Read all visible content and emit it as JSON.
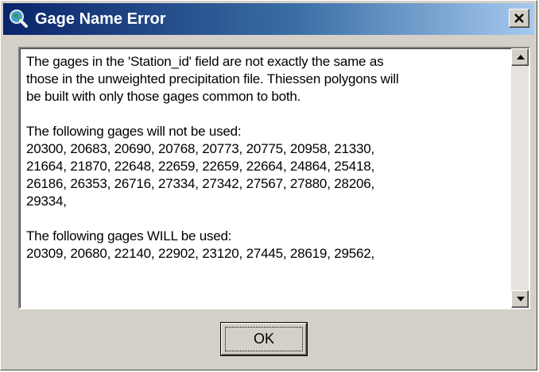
{
  "window": {
    "title": "Gage Name Error",
    "title_icon": "globe-magnifier-icon",
    "close_icon": "close-x-icon",
    "colors": {
      "titlebar_start": "#0a246a",
      "titlebar_end": "#a6caf0",
      "face": "#d4d0c8"
    }
  },
  "message": {
    "lines": [
      "The gages in the 'Station_id' field are not exactly the same as",
      "those in the unweighted precipitation file. Thiessen polygons will",
      "be built with only those gages common to both.",
      "",
      "The following gages will not be used:",
      "20300, 20683, 20690, 20768, 20773, 20775, 20958, 21330,",
      "21664, 21870, 22648, 22659, 22659, 22664, 24864, 25418,",
      "26186, 26353, 26716, 27334, 27342, 27567, 27880, 28206,",
      "29334,",
      "",
      "The following gages WILL be used:",
      "20309, 20680, 22140, 22902, 23120, 27445, 28619, 29562,"
    ]
  },
  "scrollbar": {
    "up_icon": "scroll-up-arrow-icon",
    "down_icon": "scroll-down-arrow-icon"
  },
  "buttons": {
    "ok_label": "OK"
  }
}
